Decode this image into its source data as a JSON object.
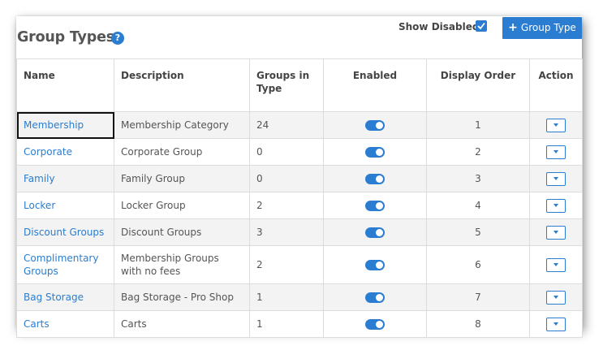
{
  "header": {
    "title": "Group Types",
    "help_icon": "question-circle-icon",
    "show_disabled_label": "Show Disabled:",
    "show_disabled_checked": true,
    "add_button_label": "Group Type"
  },
  "colors": {
    "accent": "#2a7dd0",
    "link": "#2a7dd0"
  },
  "table": {
    "columns": [
      "Name",
      "Description",
      "Groups in Type",
      "Enabled",
      "Display Order",
      "Action"
    ],
    "rows": [
      {
        "name": "Membership",
        "description": "Membership Category",
        "groups": "24",
        "enabled": true,
        "order": "1"
      },
      {
        "name": "Corporate",
        "description": "Corporate Group",
        "groups": "0",
        "enabled": true,
        "order": "2"
      },
      {
        "name": "Family",
        "description": "Family Group",
        "groups": "0",
        "enabled": true,
        "order": "3"
      },
      {
        "name": "Locker",
        "description": "Locker Group",
        "groups": "2",
        "enabled": true,
        "order": "4"
      },
      {
        "name": "Discount Groups",
        "description": "Discount Groups",
        "groups": "3",
        "enabled": true,
        "order": "5"
      },
      {
        "name": "Complimentary Groups",
        "description": "Membership Groups with no fees",
        "groups": "2",
        "enabled": true,
        "order": "6"
      },
      {
        "name": "Bag Storage",
        "description": "Bag Storage - Pro Shop",
        "groups": "1",
        "enabled": true,
        "order": "7"
      },
      {
        "name": "Carts",
        "description": "Carts",
        "groups": "1",
        "enabled": true,
        "order": "8"
      }
    ]
  }
}
